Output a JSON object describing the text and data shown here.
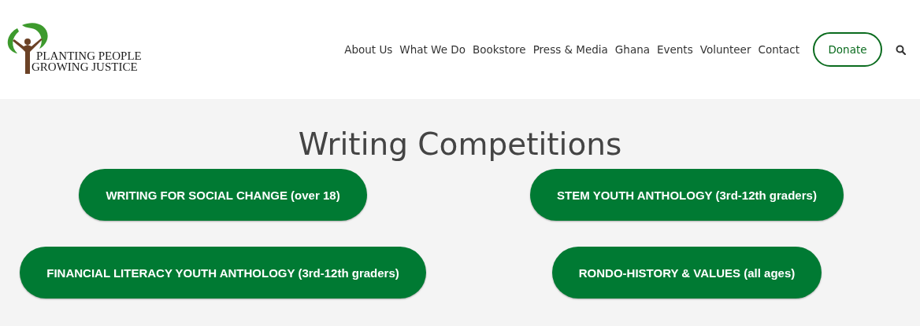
{
  "logo": {
    "line_1": "PLANTING PEOPLE",
    "line_2": "GROWING JUSTICE"
  },
  "nav": {
    "items": [
      {
        "label": "About Us"
      },
      {
        "label": "What We Do"
      },
      {
        "label": "Bookstore"
      },
      {
        "label": "Press & Media"
      },
      {
        "label": "Ghana"
      },
      {
        "label": "Events"
      },
      {
        "label": "Volunteer"
      },
      {
        "label": "Contact"
      }
    ],
    "donate": "Donate"
  },
  "title": "Writing Competitions",
  "competitions": [
    {
      "label": "WRITING FOR SOCIAL CHANGE (over 18)"
    },
    {
      "label": "STEM YOUTH ANTHOLOGY (3rd-12th graders)"
    },
    {
      "label": "FINANCIAL LITERACY YOUTH ANTHOLOGY (3rd-12th graders)"
    },
    {
      "label": "RONDO-HISTORY & VALUES (all ages)"
    }
  ]
}
